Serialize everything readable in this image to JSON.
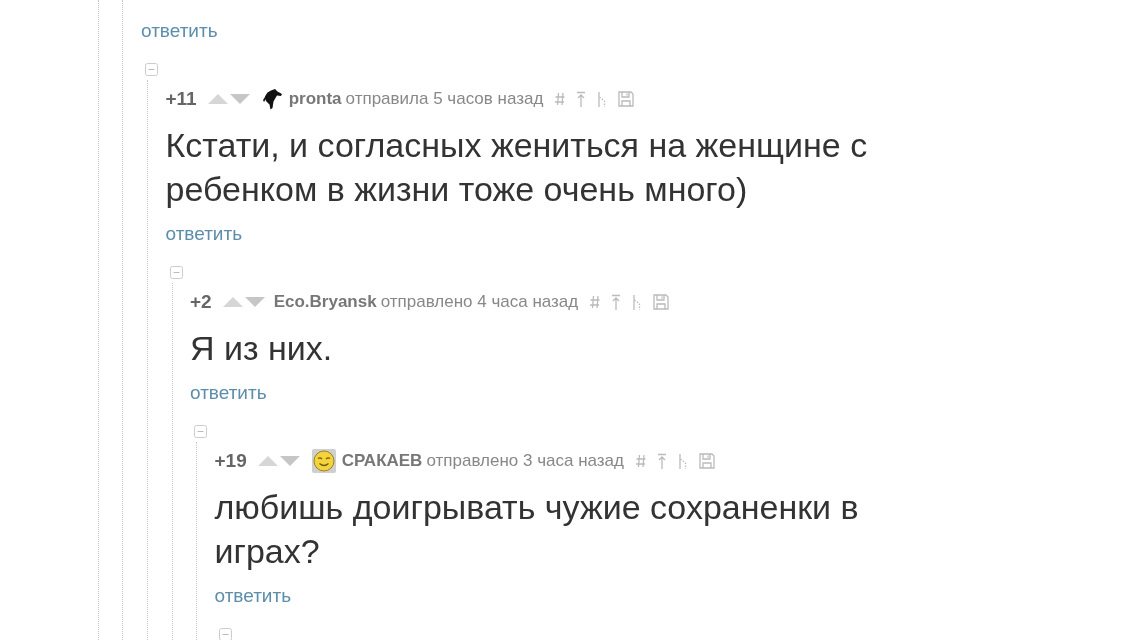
{
  "thread": {
    "reply_label": "ответить",
    "children": [
      {
        "expanded": true,
        "kind": "silhouette",
        "rating": "+11",
        "author": "pronta",
        "posted": "отправила 5 часов назад",
        "text": "Кстати, и согласных жениться на женщине с ребенком в жизни тоже очень много)",
        "reply_label": "ответить",
        "children": [
          {
            "expanded": true,
            "kind": "plain",
            "rating": "+2",
            "author": "Eco.Bryansk",
            "posted": "отправлено 4 часа назад",
            "text": "Я из них.",
            "reply_label": "ответить",
            "children": [
              {
                "expanded": true,
                "kind": "smiley",
                "rating": "+19",
                "author": "СРАКАЕВ",
                "posted": "отправлено 3 часа назад",
                "text": "любишь доигрывать чужие сохраненки в играх?",
                "reply_label": "ответить",
                "children": [
                  {
                    "expanded": true
                  }
                ]
              }
            ]
          }
        ]
      }
    ]
  }
}
